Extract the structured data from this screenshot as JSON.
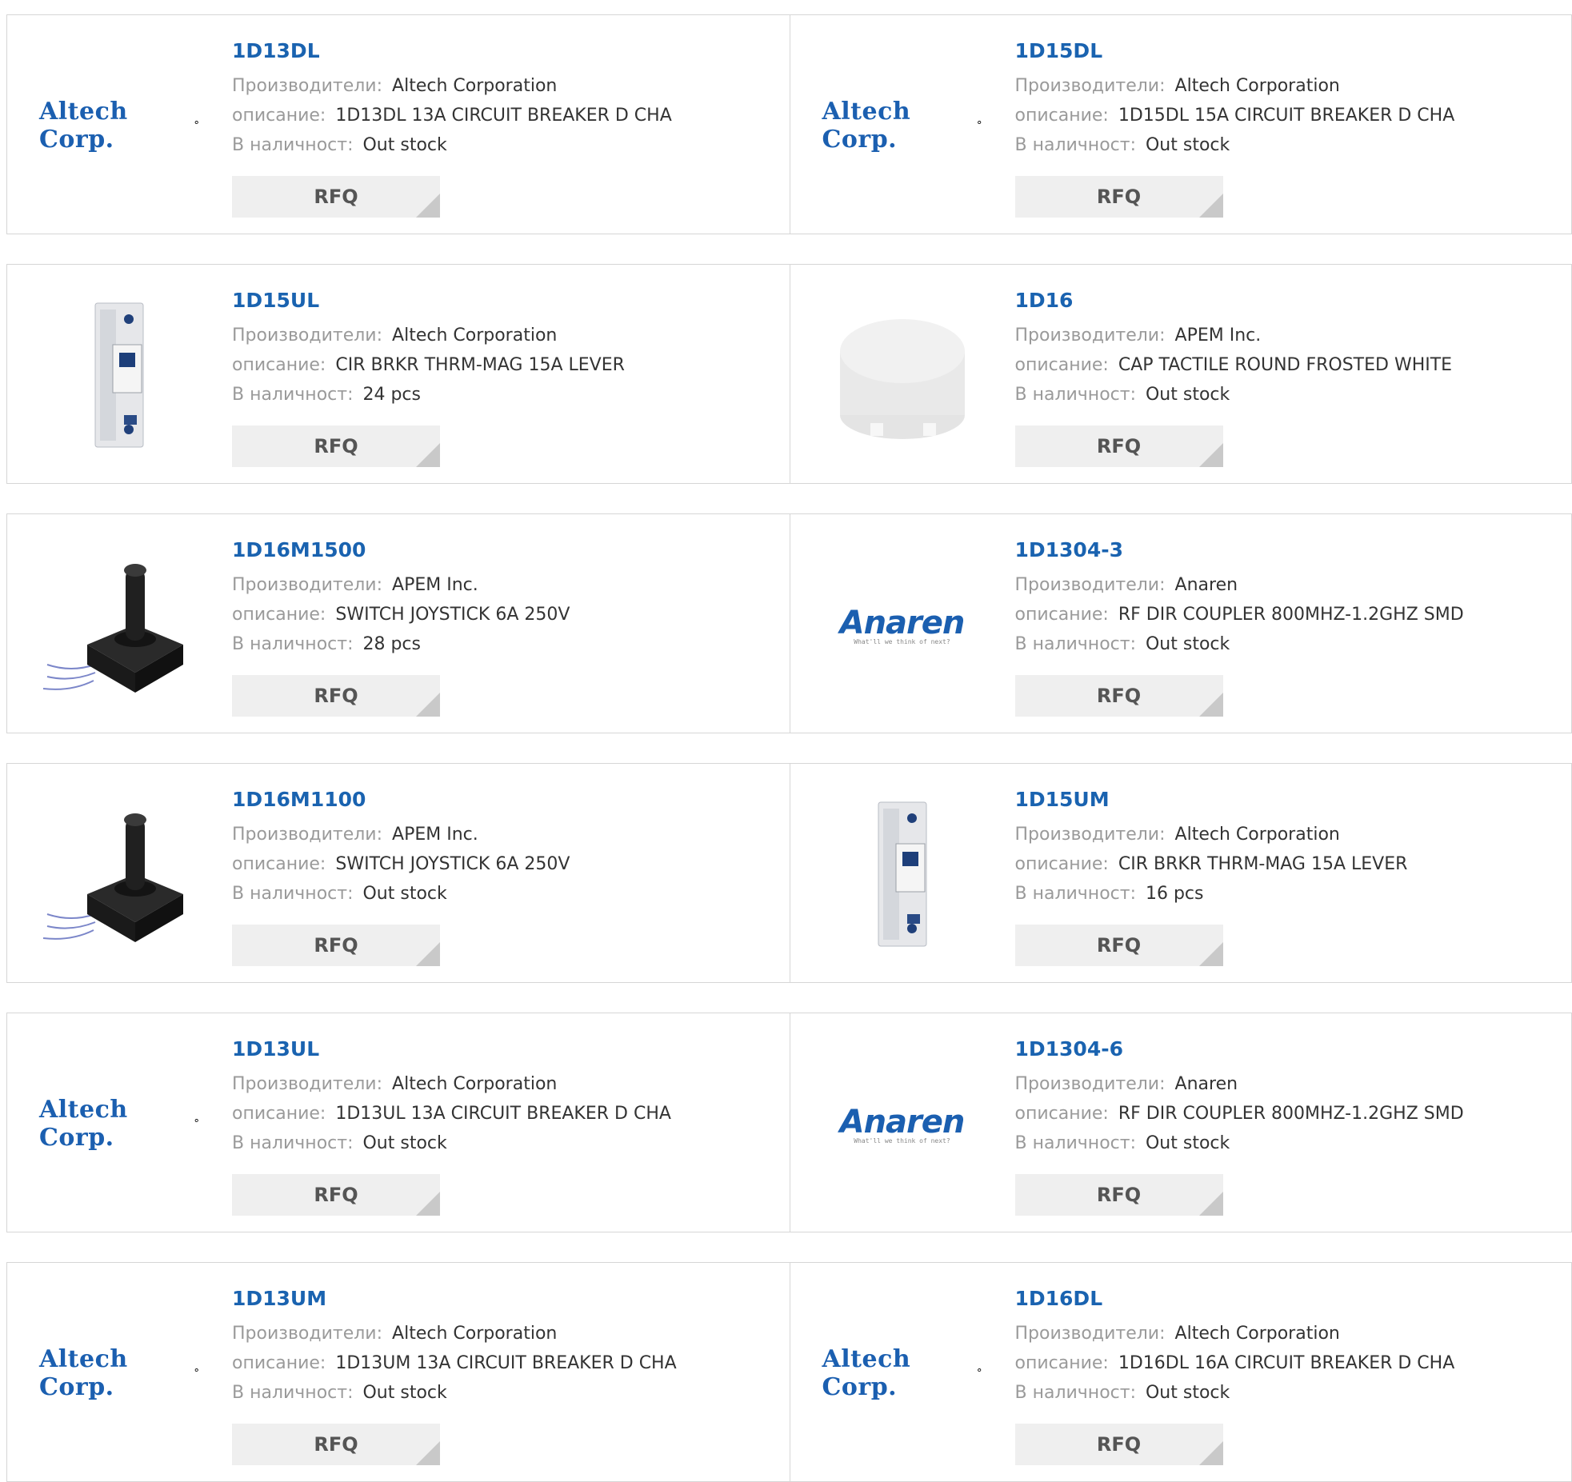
{
  "labels": {
    "manufacturer": "Производители:",
    "description": "описание:",
    "stock": "В наличност:",
    "rfq": "RFQ"
  },
  "colors": {
    "link": "#1a63b0",
    "label": "#9a9a9a",
    "value": "#333333",
    "button_bg": "#efefef",
    "border": "#d6d6d6"
  },
  "products": [
    {
      "part": "1D13DL",
      "manufacturer": "Altech Corporation",
      "description": "1D13DL 13A CIRCUIT BREAKER D CHA",
      "stock": "Out stock",
      "image": "altech-logo",
      "logo_text": "Altech Corp."
    },
    {
      "part": "1D15DL",
      "manufacturer": "Altech Corporation",
      "description": "1D15DL 15A CIRCUIT BREAKER D CHA",
      "stock": "Out stock",
      "image": "altech-logo",
      "logo_text": "Altech Corp."
    },
    {
      "part": "1D15UL",
      "manufacturer": "Altech Corporation",
      "description": "CIR BRKR THRM-MAG 15A LEVER",
      "stock": "24 pcs",
      "image": "circuit-breaker-photo"
    },
    {
      "part": "1D16",
      "manufacturer": "APEM Inc.",
      "description": "CAP TACTILE ROUND FROSTED WHITE",
      "stock": "Out stock",
      "image": "tactile-cap-photo"
    },
    {
      "part": "1D16M1500",
      "manufacturer": "APEM Inc.",
      "description": "SWITCH JOYSTICK 6A 250V",
      "stock": "28 pcs",
      "image": "joystick-photo"
    },
    {
      "part": "1D1304-3",
      "manufacturer": "Anaren",
      "description": "RF DIR COUPLER 800MHZ-1.2GHZ SMD",
      "stock": "Out stock",
      "image": "anaren-logo",
      "logo_text": "Anaren",
      "logo_tagline": "What'll we think of next?"
    },
    {
      "part": "1D16M1100",
      "manufacturer": "APEM Inc.",
      "description": "SWITCH JOYSTICK 6A 250V",
      "stock": "Out stock",
      "image": "joystick-photo"
    },
    {
      "part": "1D15UM",
      "manufacturer": "Altech Corporation",
      "description": "CIR BRKR THRM-MAG 15A LEVER",
      "stock": "16 pcs",
      "image": "circuit-breaker-photo"
    },
    {
      "part": "1D13UL",
      "manufacturer": "Altech Corporation",
      "description": "1D13UL 13A CIRCUIT BREAKER D CHA",
      "stock": "Out stock",
      "image": "altech-logo",
      "logo_text": "Altech Corp."
    },
    {
      "part": "1D1304-6",
      "manufacturer": "Anaren",
      "description": "RF DIR COUPLER 800MHZ-1.2GHZ SMD",
      "stock": "Out stock",
      "image": "anaren-logo",
      "logo_text": "Anaren",
      "logo_tagline": "What'll we think of next?"
    },
    {
      "part": "1D13UM",
      "manufacturer": "Altech Corporation",
      "description": "1D13UM 13A CIRCUIT BREAKER D CHA",
      "stock": "Out stock",
      "image": "altech-logo",
      "logo_text": "Altech Corp."
    },
    {
      "part": "1D16DL",
      "manufacturer": "Altech Corporation",
      "description": "1D16DL 16A CIRCUIT BREAKER D CHA",
      "stock": "Out stock",
      "image": "altech-logo",
      "logo_text": "Altech Corp."
    }
  ]
}
